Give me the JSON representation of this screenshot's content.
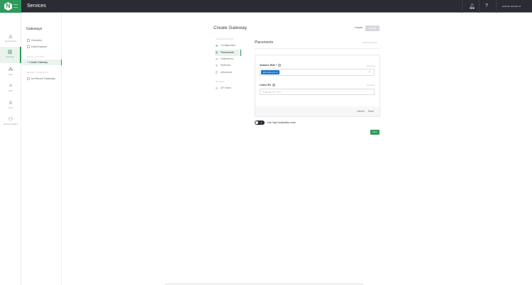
{
  "header": {
    "title": "Services",
    "user": "admin admin",
    "icons": [
      "bell-icon",
      "help-icon",
      "chevron-down-icon"
    ]
  },
  "rail": [
    {
      "label": "Environments",
      "icon": "◬"
    },
    {
      "label": "Gateways",
      "icon": "▥"
    },
    {
      "label": "Apps",
      "icon": "⁂"
    },
    {
      "label": "APIs",
      "icon": "✧"
    },
    {
      "label": "Certs",
      "icon": "♕"
    },
    {
      "label": "Identity Providers",
      "icon": "⚇"
    }
  ],
  "sidebar": {
    "title": "Gateways",
    "items": [
      "Overview",
      "Data Explorer"
    ],
    "quick_actions_label": "QUICK ACTIONS",
    "create": "Create Gateway",
    "recent_label": "RECENT GATEWAYS",
    "recent_empty": "No Recent Gateways"
  },
  "page": {
    "title": "Create Gateway",
    "cancel": "Cancel",
    "submit": "Submit"
  },
  "steps": {
    "config_label": "CONFIGURATION",
    "items": [
      "Configuration",
      "Placements",
      "Hostnames",
      "Methods",
      "Advanced"
    ],
    "review_label": "REVIEW",
    "review_items": [
      "API Spec"
    ]
  },
  "placements": {
    "title": "Placements",
    "add": "Add Placement",
    "instance_refs": {
      "label": "Instance Refs *",
      "hint": "Required",
      "tag": "nginx-plus-vm-1 ×"
    },
    "listen_ips": {
      "label": "Listen IPs",
      "hint": "Optional",
      "placeholder": "Example: IP1, IP2"
    },
    "cancel": "Cancel",
    "done": "Done"
  },
  "ha": {
    "label": "Use High Availability mode",
    "toggle_text": "✕",
    "enabled": false
  },
  "next": "Next"
}
